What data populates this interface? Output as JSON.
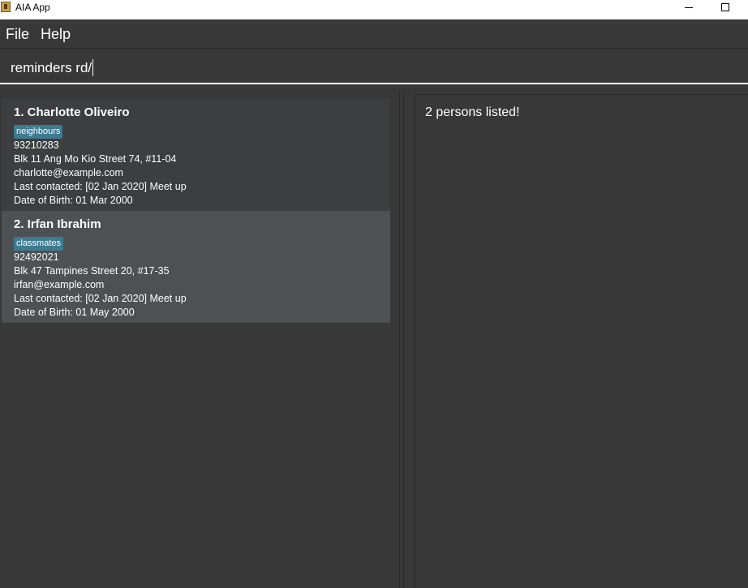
{
  "window": {
    "title": "AIA App"
  },
  "menu": {
    "file": "File",
    "help": "Help"
  },
  "command": {
    "value": "reminders rd/"
  },
  "persons": [
    {
      "index_name": "1.  Charlotte Oliveiro",
      "tag": "neighbours",
      "phone": "93210283",
      "address": "Blk 11 Ang Mo Kio Street 74, #11-04",
      "email": "charlotte@example.com",
      "last_contacted": "Last contacted: [02 Jan 2020] Meet up",
      "dob": "Date of Birth: 01 Mar 2000"
    },
    {
      "index_name": "2.  Irfan Ibrahim",
      "tag": "classmates",
      "phone": "92492021",
      "address": "Blk 47 Tampines Street 20, #17-35",
      "email": "irfan@example.com",
      "last_contacted": "Last contacted: [02 Jan 2020] Meet up",
      "dob": "Date of Birth: 01 May 2000"
    }
  ],
  "result": {
    "message": "2 persons listed!"
  },
  "colors": {
    "background": "#383838",
    "card_odd": "#3c3e3f",
    "card_selected": "#4d5153",
    "tag": "#3e7b91"
  }
}
